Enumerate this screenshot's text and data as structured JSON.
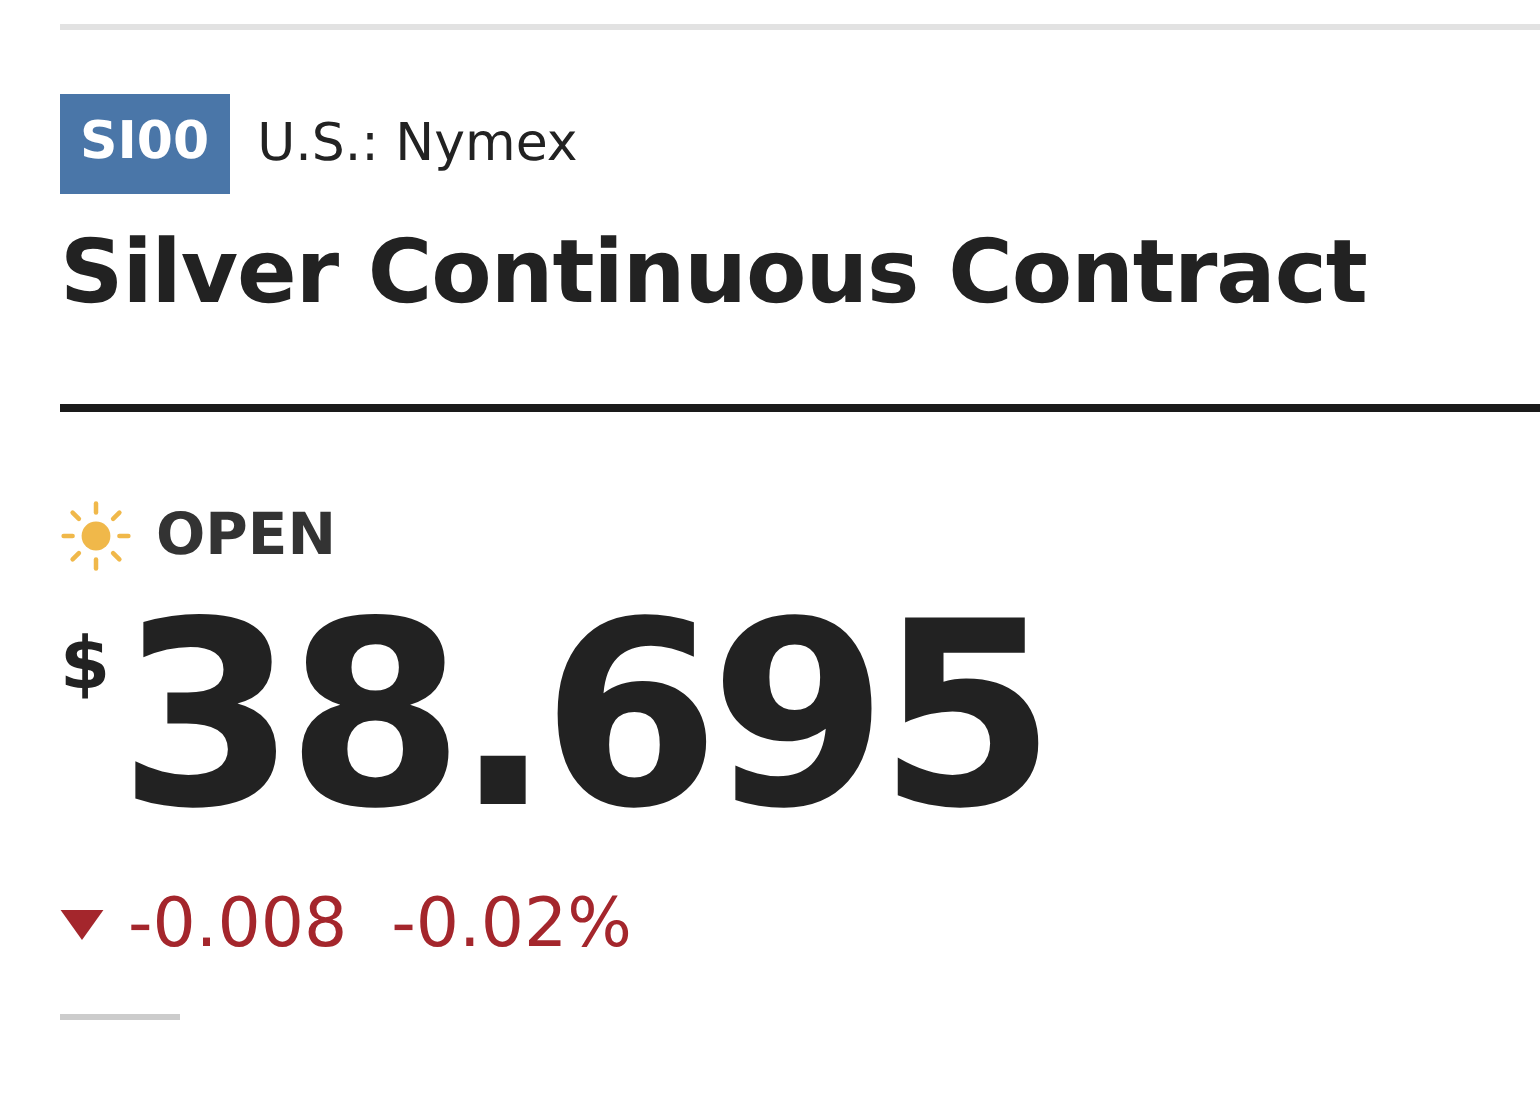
{
  "symbol": "SI00",
  "exchange": "U.S.: Nymex",
  "title": "Silver Continuous Contract",
  "status": {
    "open": true,
    "label": "OPEN"
  },
  "price": {
    "currency": "$",
    "value": "38.695"
  },
  "change": {
    "falling": true,
    "amount": "-0.008",
    "percent": "-0.02%"
  }
}
